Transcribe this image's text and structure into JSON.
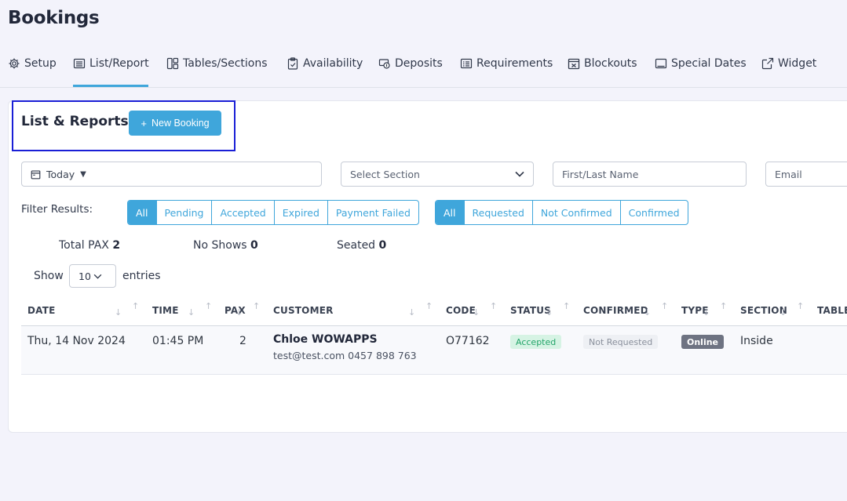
{
  "page": {
    "title": "Bookings"
  },
  "tabs": [
    {
      "label": "Setup",
      "icon": "gear-icon"
    },
    {
      "label": "List/Report",
      "icon": "list-icon",
      "active": true
    },
    {
      "label": "Tables/Sections",
      "icon": "layout-icon"
    },
    {
      "label": "Availability",
      "icon": "clipboard-check-icon"
    },
    {
      "label": "Deposits",
      "icon": "money-icon"
    },
    {
      "label": "Requirements",
      "icon": "list-details-icon"
    },
    {
      "label": "Blockouts",
      "icon": "calendar-x-icon"
    },
    {
      "label": "Special Dates",
      "icon": "calendar-icon"
    },
    {
      "label": "Widget",
      "icon": "external-link-icon"
    }
  ],
  "card": {
    "title": "List & Reports",
    "new_booking_label": "New Booking",
    "new_booking_icon": "plus-icon"
  },
  "filters": {
    "date_value": "Today",
    "section_placeholder": "Select Section",
    "name_placeholder": "First/Last Name",
    "email_placeholder": "Email",
    "label": "Filter Results:",
    "status_options": [
      "All",
      "Pending",
      "Accepted",
      "Expired",
      "Payment Failed"
    ],
    "status_selected": "All",
    "confirm_options": [
      "All",
      "Requested",
      "Not Confirmed",
      "Confirmed"
    ],
    "confirm_selected": "All"
  },
  "stats": {
    "total_pax_label": "Total PAX",
    "total_pax": "2",
    "no_shows_label": "No Shows",
    "no_shows": "0",
    "seated_label": "Seated",
    "seated": "0"
  },
  "entries": {
    "show_label": "Show",
    "value": "10",
    "entries_label": "entries"
  },
  "table": {
    "columns": [
      "DATE",
      "TIME",
      "PAX",
      "CUSTOMER",
      "CODE",
      "STATUS",
      "CONFIRMED",
      "TYPE",
      "SECTION",
      "TABLE"
    ],
    "rows": [
      {
        "date": "Thu, 14 Nov 2024",
        "time": "01:45 PM",
        "pax": "2",
        "customer_name": "Chloe WOWAPPS",
        "customer_contact": "test@test.com 0457 898 763",
        "code": "O77162",
        "status": "Accepted",
        "confirmed": "Not Requested",
        "type": "Online",
        "section": "Inside"
      }
    ]
  },
  "colors": {
    "accent": "#3fa6db",
    "highlight": "#1a1fd6",
    "accepted_text": "#24a56a",
    "accepted_bg": "#d6f3e4",
    "online_bg": "#6e7382"
  }
}
